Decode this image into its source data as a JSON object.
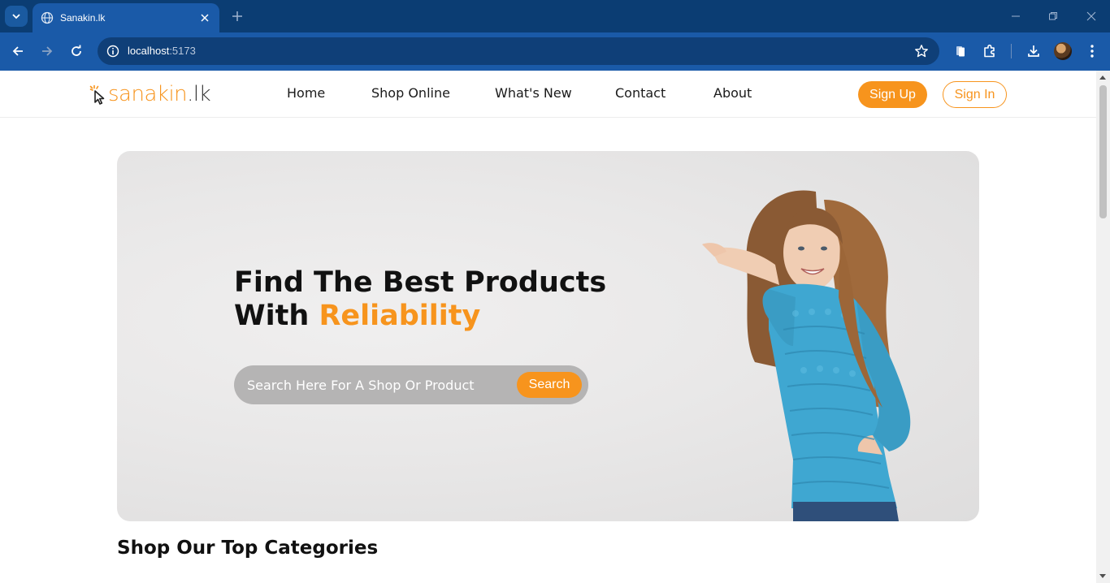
{
  "browser": {
    "tab_title": "Sanakin.lk",
    "url_host": "localhost",
    "url_port": ":5173"
  },
  "site": {
    "logo": {
      "main": "sanakin",
      "tld": ".lk"
    },
    "nav": [
      {
        "label": "Home"
      },
      {
        "label": "Shop Online"
      },
      {
        "label": "What's New"
      },
      {
        "label": "Contact"
      },
      {
        "label": "About"
      }
    ],
    "signup_label": "Sign Up",
    "signin_label": "Sign In"
  },
  "hero": {
    "title_line1": "Find The Best Products",
    "title_line2_prefix": "With ",
    "title_line2_accent": "Reliability",
    "search_placeholder": "Search Here For A Shop Or Product",
    "search_button": "Search",
    "image": "smiling woman in blue knit sweater presenting with open palm"
  },
  "sections": {
    "top_categories_title": "Shop Our Top Categories"
  },
  "colors": {
    "brand_accent": "#f7941d",
    "browser_frame": "#0b3d73",
    "browser_toolbar": "#1a5aa8"
  },
  "icons": {
    "tab_list": "chevron-down-icon",
    "favicon": "globe-icon",
    "back": "arrow-left-icon",
    "forward": "arrow-right-icon",
    "reload": "reload-icon",
    "site_info": "info-icon",
    "bookmark": "star-icon",
    "extensions": "puzzle-icon",
    "downloads": "download-icon",
    "menu": "kebab-menu-icon"
  }
}
